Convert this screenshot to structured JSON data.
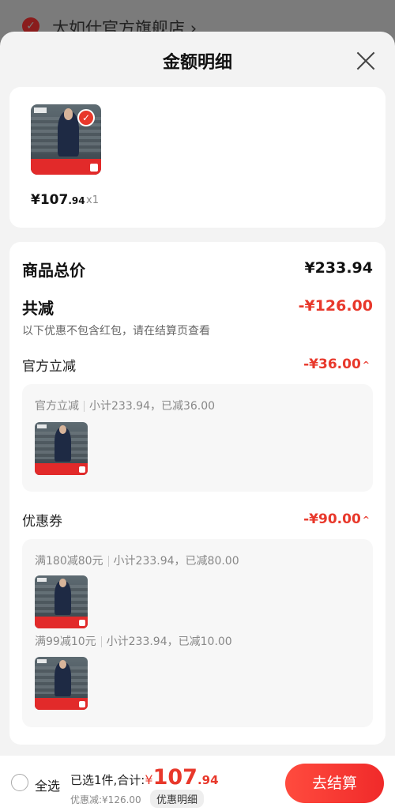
{
  "store": {
    "name": "太如仕官方旗舰店",
    "chevron": "›",
    "check_icon": "check-circle-icon"
  },
  "sheet": {
    "title": "金额明细",
    "close_icon": "close-icon"
  },
  "product": {
    "price_main": "¥107",
    "price_decimal": ".94",
    "quantity": "x1",
    "selected": true
  },
  "summary": {
    "total_label": "商品总价",
    "total_value": "¥233.94",
    "discount_label": "共减",
    "discount_value": "-¥126.00",
    "note": "以下优惠不包含红包，请在结算页查看"
  },
  "official": {
    "label": "官方立减",
    "value": "-¥36.00",
    "caret": "^",
    "box_title": "官方立减",
    "box_detail": "小计233.94，已减36.00"
  },
  "coupon": {
    "label": "优惠券",
    "value": "-¥90.00",
    "caret": "^",
    "items": [
      {
        "title": "满180减80元",
        "detail": "小计233.94，已减80.00"
      },
      {
        "title": "满99减10元",
        "detail": "小计233.94，已减10.00"
      }
    ]
  },
  "bottom": {
    "select_all": "全选",
    "selected_text": "已选1件,合计:",
    "currency": "¥",
    "total_main": "107",
    "total_decimal": ".94",
    "discount_text": "优惠减:¥126.00",
    "detail_chip": "优惠明细",
    "checkout": "去结算"
  },
  "colors": {
    "accent": "#e8382b",
    "background": "#f3f3f3",
    "card": "#ffffff"
  }
}
